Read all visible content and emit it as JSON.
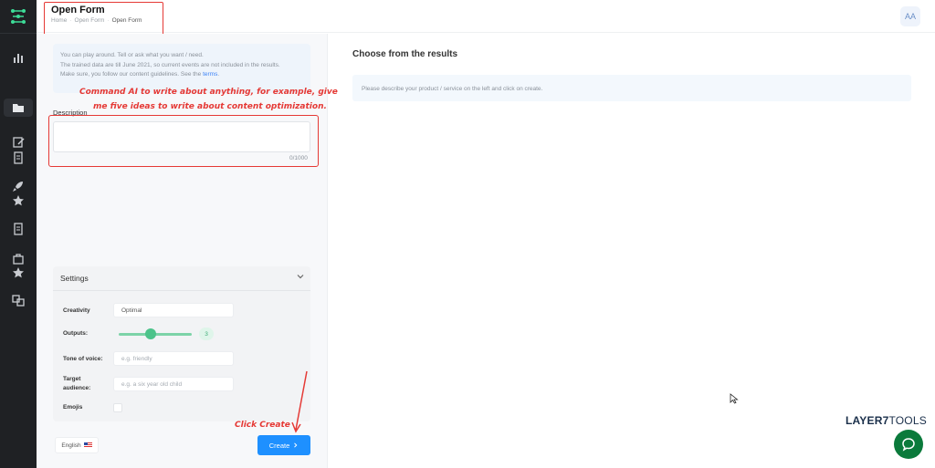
{
  "header": {
    "title": "Open Form",
    "breadcrumb": [
      "Home",
      "Open Form",
      "Open Form"
    ],
    "avatar_initials": "AA"
  },
  "sidebar": {
    "icons": [
      "logo-icon",
      "chart-icon",
      "folder-icon",
      "edit-icon",
      "document-icon",
      "rocket-icon",
      "star-icon",
      "document-icon",
      "bag-icon",
      "star-icon",
      "translate-icon"
    ]
  },
  "info": {
    "line1": "You can play around. Tell or ask what you want / need.",
    "line2": "The trained data are till June 2021, so current events are not included in the results.",
    "line3_prefix": "Make sure, you follow our content guidelines. See the ",
    "line3_link": "terms",
    "line3_suffix": "."
  },
  "annotations": {
    "command_line1": "Command AI to write about anything, for example, give",
    "command_line2": "me five ideas to write about content optimization.",
    "click_create": "Click Create"
  },
  "description": {
    "label": "Description",
    "value": "",
    "counter": "0/1000"
  },
  "settings": {
    "title": "Settings",
    "creativity_label": "Creativity",
    "creativity_value": "Optimal",
    "outputs_label": "Outputs:",
    "outputs_value": "3",
    "outputs_fraction": 0.5,
    "tone_label": "Tone of voice:",
    "tone_placeholder": "e.g. friendly",
    "audience_label_line1": "Target",
    "audience_label_line2": "audience:",
    "audience_placeholder": "e.g. a six year old child",
    "emojis_label": "Emojis",
    "emojis_checked": false
  },
  "footer": {
    "language": "English",
    "create_label": "Create"
  },
  "results": {
    "title": "Choose from the results",
    "empty_text": "Please describe your product / service on the left and click on create."
  },
  "watermark": {
    "part1": "LAYER7",
    "part2": "TOOLS"
  },
  "colors": {
    "accent": "#1e90ff",
    "slider": "#4cc38a",
    "annotation": "#e53935",
    "sidebar": "#1f2124"
  }
}
